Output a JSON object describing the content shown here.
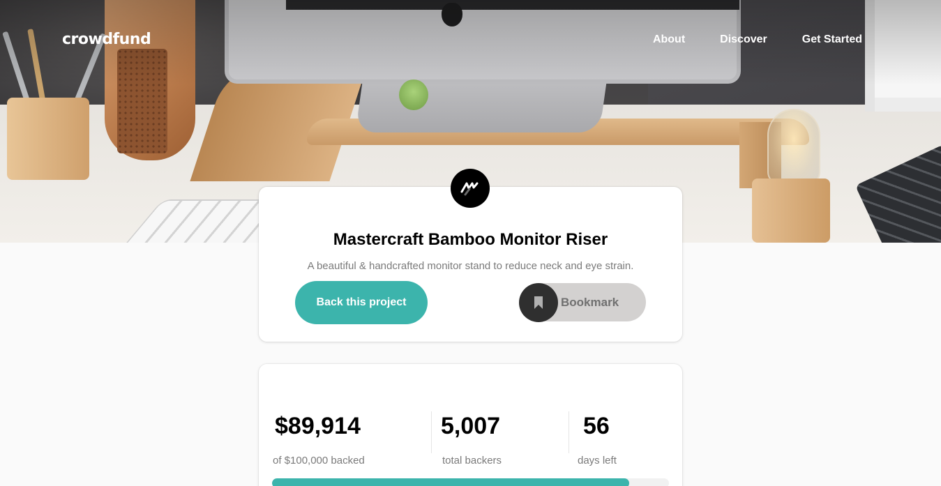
{
  "header": {
    "logo": "crowdfund",
    "nav": [
      {
        "label": "About"
      },
      {
        "label": "Discover"
      },
      {
        "label": "Get Started"
      }
    ]
  },
  "project": {
    "title": "Mastercraft Bamboo Monitor Riser",
    "description": "A beautiful & handcrafted monitor stand to reduce neck and eye strain.",
    "back_button_label": "Back this project",
    "bookmark_label": "Bookmark",
    "brand_icon": "mastercraft-logo-icon"
  },
  "stats": {
    "backed_amount": "$89,914",
    "backed_label": "of $100,000 backed",
    "total_backers": "5,007",
    "total_backers_label": "total backers",
    "days_left": "56",
    "days_left_label": "days left",
    "progress_fraction": 0.89914
  },
  "colors": {
    "accent": "#3cb4ac",
    "dark": "#2f2f2f",
    "muted_text": "#7a7a7a"
  }
}
